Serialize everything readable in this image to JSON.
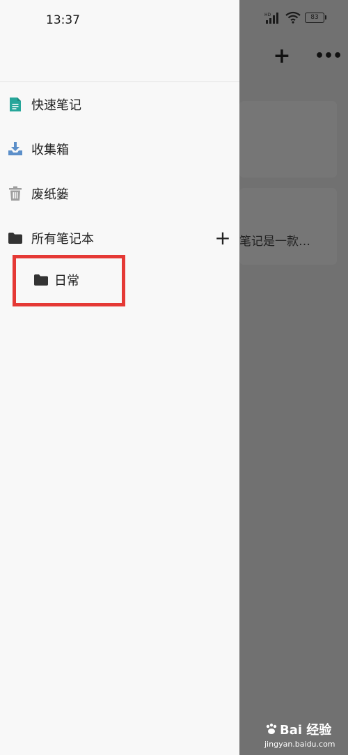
{
  "status_bar": {
    "time": "13:37",
    "battery": "83",
    "hd_label": "HD"
  },
  "background_app": {
    "note_snippet": "笔记是一款…"
  },
  "drawer": {
    "items": [
      {
        "label": "快速笔记",
        "icon": "note-icon",
        "color": "#26a69a"
      },
      {
        "label": "收集箱",
        "icon": "inbox-download-icon",
        "color": "#5c8fc9"
      },
      {
        "label": "废纸篓",
        "icon": "trash-icon",
        "color": "#9e9e9e"
      },
      {
        "label": "所有笔记本",
        "icon": "folder-icon",
        "color": "#333333"
      }
    ],
    "notebooks": [
      {
        "label": "日常",
        "icon": "folder-icon"
      }
    ]
  },
  "colors": {
    "highlight": "#e53935",
    "overlay": "#717171",
    "drawer_bg": "#f8f8f8"
  },
  "watermark": {
    "brand": "Bai 经验",
    "url": "jingyan.baidu.com"
  }
}
